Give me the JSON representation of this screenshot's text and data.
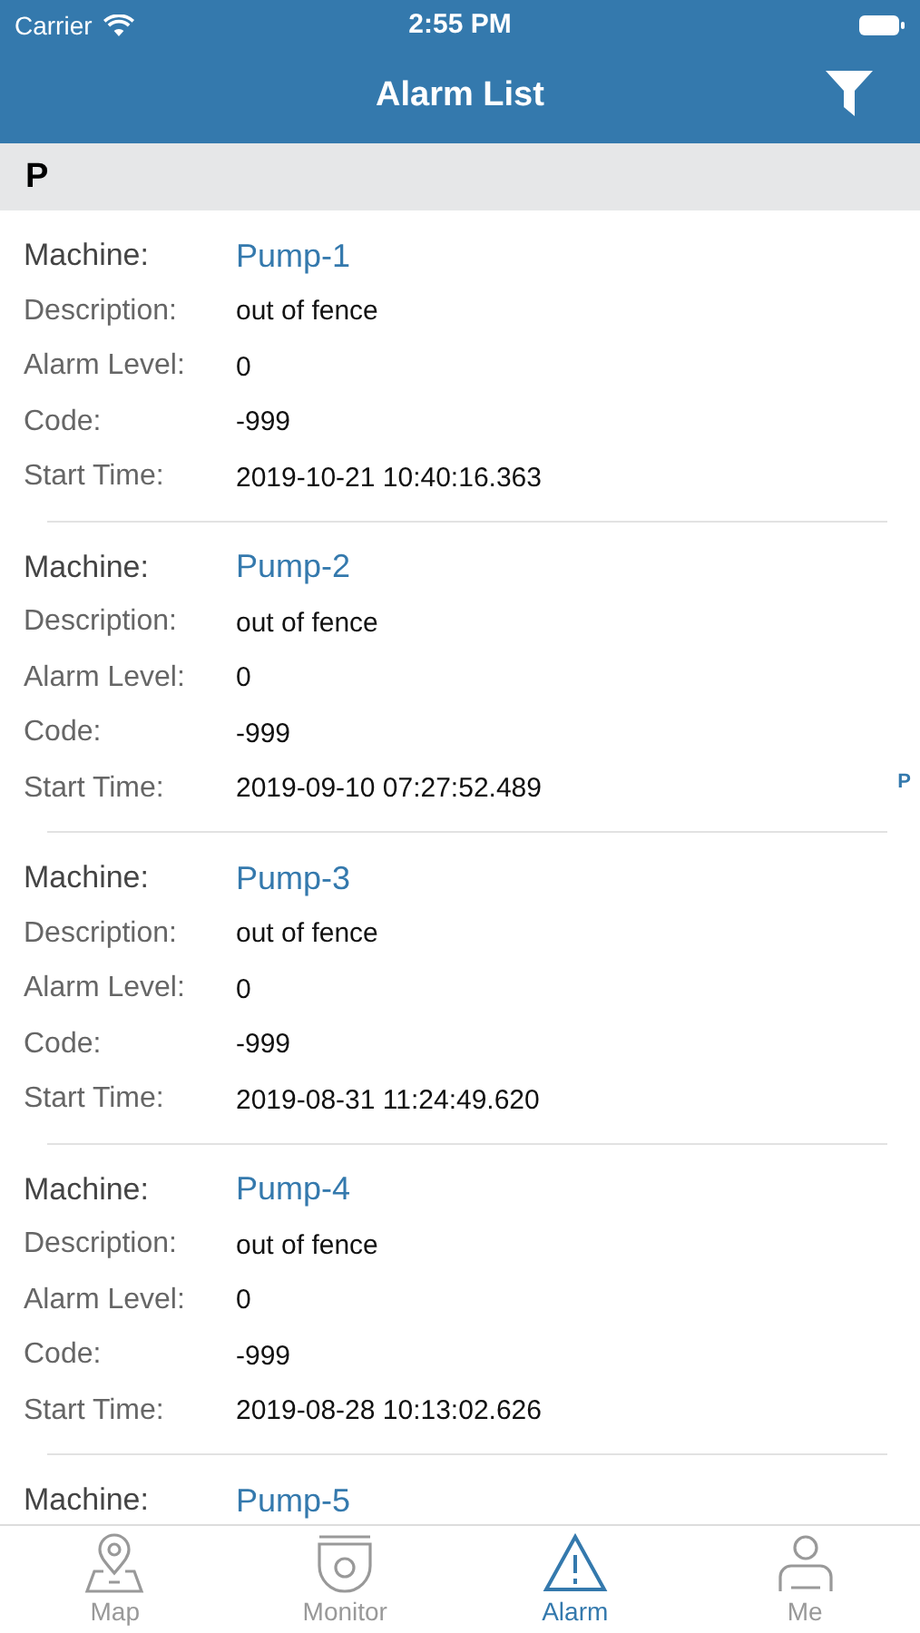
{
  "status_bar": {
    "carrier": "Carrier",
    "time": "2:55 PM"
  },
  "nav": {
    "title": "Alarm List"
  },
  "section": {
    "letter": "P"
  },
  "index": [
    "P"
  ],
  "records": [
    {
      "rows": [
        {
          "kind": "machine",
          "label": "Machine:",
          "value": "Pump-1"
        },
        {
          "kind": "field",
          "label": "Description:",
          "value": "out of fence"
        },
        {
          "kind": "field",
          "label": "Alarm Level:",
          "value": "0"
        },
        {
          "kind": "field",
          "label": "Code:",
          "value": "-999"
        },
        {
          "kind": "field",
          "label": "Start Time:",
          "value": "2019-10-21 10:40:16.363"
        }
      ]
    },
    {
      "rows": [
        {
          "kind": "machine",
          "label": "Machine:",
          "value": "Pump-2"
        },
        {
          "kind": "field",
          "label": "Description:",
          "value": "out of fence"
        },
        {
          "kind": "field",
          "label": "Alarm Level:",
          "value": "0"
        },
        {
          "kind": "field",
          "label": "Code:",
          "value": "-999"
        },
        {
          "kind": "field",
          "label": "Start Time:",
          "value": "2019-09-10 07:27:52.489"
        }
      ]
    },
    {
      "rows": [
        {
          "kind": "machine",
          "label": "Machine:",
          "value": "Pump-3"
        },
        {
          "kind": "field",
          "label": "Description:",
          "value": "out of fence"
        },
        {
          "kind": "field",
          "label": "Alarm Level:",
          "value": "0"
        },
        {
          "kind": "field",
          "label": "Code:",
          "value": "-999"
        },
        {
          "kind": "field",
          "label": "Start Time:",
          "value": "2019-08-31 11:24:49.620"
        }
      ]
    },
    {
      "rows": [
        {
          "kind": "machine",
          "label": "Machine:",
          "value": "Pump-4"
        },
        {
          "kind": "field",
          "label": "Description:",
          "value": "out of fence"
        },
        {
          "kind": "field",
          "label": "Alarm Level:",
          "value": "0"
        },
        {
          "kind": "field",
          "label": "Code:",
          "value": "-999"
        },
        {
          "kind": "field",
          "label": "Start Time:",
          "value": "2019-08-28 10:13:02.626"
        }
      ]
    },
    {
      "rows": [
        {
          "kind": "machine",
          "label": "Machine:",
          "value": "Pump-5"
        }
      ]
    }
  ],
  "tabs": [
    {
      "kind": "map",
      "label": "Map",
      "selected": false
    },
    {
      "kind": "monitor",
      "label": "Monitor",
      "selected": false
    },
    {
      "kind": "alarm",
      "label": "Alarm",
      "selected": true
    },
    {
      "kind": "me",
      "label": "Me",
      "selected": false
    }
  ]
}
